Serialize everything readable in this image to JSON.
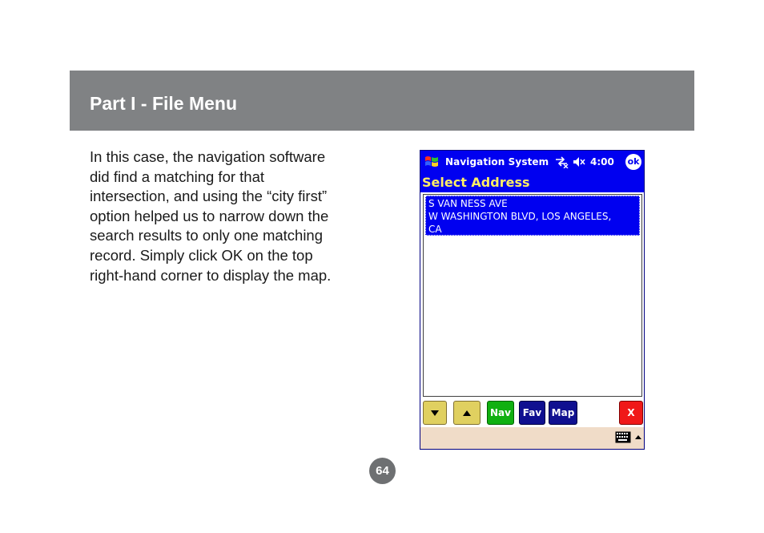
{
  "header": {
    "title": "Part I - File Menu"
  },
  "body_lines": [
    "In this case, the navigation software",
    "did find a matching for that",
    "intersection, and using the “city first”",
    "option helped us to narrow down the",
    "search results to only one matching",
    "record.  Simply click OK on the top",
    "right-hand corner to display the map."
  ],
  "device": {
    "title": "Navigation System",
    "clock": "4:00",
    "ok_label": "ok",
    "subtitle": "Select Address",
    "list_item_lines": [
      "S VAN NESS AVE",
      "W WASHINGTON BLVD, LOS ANGELES,",
      "CA"
    ],
    "buttons": {
      "nav": "Nav",
      "fav": "Fav",
      "map": "Map",
      "close": "X"
    },
    "icons": [
      "windows-start-icon",
      "connectivity-icon",
      "volume-icon",
      "down-arrow-icon",
      "up-arrow-icon",
      "keyboard-icon",
      "sip-up-arrow-icon"
    ],
    "colors": {
      "titlebar": "#0000f0",
      "subtitle_text": "#ffee66",
      "nav_button": "#10b010",
      "close_button": "#f01818"
    }
  },
  "page_number": "64"
}
